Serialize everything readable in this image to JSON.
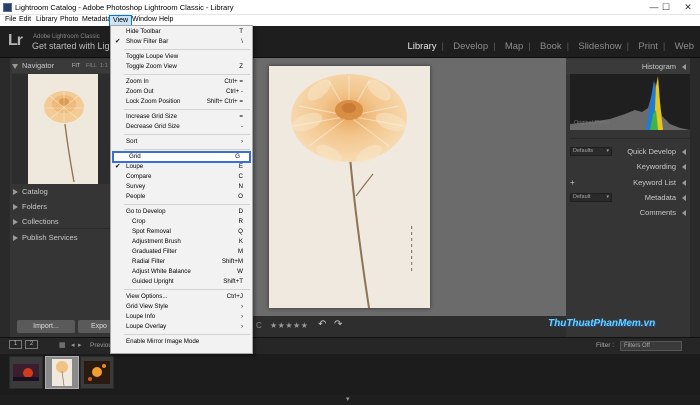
{
  "window": {
    "title": "Lightroom Catalog - Adobe Photoshop Lightroom Classic - Library",
    "controls": [
      "—",
      "☐",
      "✕"
    ]
  },
  "menubar": [
    "File",
    "Edit",
    "Library",
    "Photo",
    "Metadata",
    "View",
    "Window",
    "Help"
  ],
  "identity": {
    "logo": "Lr",
    "subtitle": "Adobe Lightroom Classic",
    "tagline": "Get started with Lightr"
  },
  "modules": [
    "Library",
    "Develop",
    "Map",
    "Book",
    "Slideshow",
    "Print",
    "Web"
  ],
  "active_module": "Library",
  "left_panel": {
    "navigator": {
      "label": "Navigator",
      "fit": "FIT",
      "fill": "FILL",
      "zoom": "1:1"
    },
    "sections": [
      "Catalog",
      "Folders",
      "Collections",
      "Publish Services"
    ],
    "import_label": "Import...",
    "export_label": "Expo"
  },
  "right_panel": {
    "histogram_label": "Histogram",
    "original_photo": "Original Photo",
    "quick_develop": "Quick Develop",
    "quick_develop_preset": "Defaults",
    "keywording": "Keywording",
    "keyword_list": "Keyword List",
    "metadata": "Metadata",
    "metadata_preset": "Default",
    "comments": "Comments"
  },
  "toolbar": {
    "rating": "★★★★★",
    "prefix": "C"
  },
  "filmstrip": {
    "page1": "1",
    "page2": "2",
    "previous": "Previou",
    "filter_label": "Filter :",
    "filter_value": "Filters Off"
  },
  "watermark": "ThuThuatPhanMem.vn",
  "view_menu": {
    "items": [
      {
        "label": "Hide Toolbar",
        "shortcut": "T"
      },
      {
        "label": "Show Filter Bar",
        "shortcut": "\\",
        "checked": true
      },
      {
        "sep": true
      },
      {
        "label": "Toggle Loupe View",
        "shortcut": ""
      },
      {
        "label": "Toggle Zoom View",
        "shortcut": "Z"
      },
      {
        "sep": true
      },
      {
        "label": "Zoom In",
        "shortcut": "Ctrl+ ="
      },
      {
        "label": "Zoom Out",
        "shortcut": "Ctrl+ -"
      },
      {
        "label": "Lock Zoom Position",
        "shortcut": "Shift+ Ctrl+ ="
      },
      {
        "sep": true
      },
      {
        "label": "Increase Grid Size",
        "shortcut": "="
      },
      {
        "label": "Decrease Grid Size",
        "shortcut": "-"
      },
      {
        "sep": true
      },
      {
        "label": "Sort",
        "shortcut": "›"
      },
      {
        "sep": true
      },
      {
        "label": "Grid",
        "shortcut": "G",
        "highlight": true
      },
      {
        "label": "Loupe",
        "shortcut": "E",
        "checked": true
      },
      {
        "label": "Compare",
        "shortcut": "C"
      },
      {
        "label": "Survey",
        "shortcut": "N"
      },
      {
        "label": "People",
        "shortcut": "O"
      },
      {
        "sep": true
      },
      {
        "label": "Go to Develop",
        "shortcut": "D"
      },
      {
        "label": "Crop",
        "shortcut": "R",
        "indent": true
      },
      {
        "label": "Spot Removal",
        "shortcut": "Q",
        "indent": true
      },
      {
        "label": "Adjustment Brush",
        "shortcut": "K",
        "indent": true
      },
      {
        "label": "Graduated Filter",
        "shortcut": "M",
        "indent": true
      },
      {
        "label": "Radial Filter",
        "shortcut": "Shift+M",
        "indent": true
      },
      {
        "label": "Adjust White Balance",
        "shortcut": "W",
        "indent": true
      },
      {
        "label": "Guided Upright",
        "shortcut": "Shift+T",
        "indent": true
      },
      {
        "sep": true
      },
      {
        "label": "View Options...",
        "shortcut": "Ctrl+J"
      },
      {
        "label": "Grid View Style",
        "shortcut": "›"
      },
      {
        "label": "Loupe Info",
        "shortcut": "›"
      },
      {
        "label": "Loupe Overlay",
        "shortcut": "›"
      },
      {
        "sep": true
      },
      {
        "label": "Enable Mirror Image Mode",
        "shortcut": ""
      }
    ]
  }
}
